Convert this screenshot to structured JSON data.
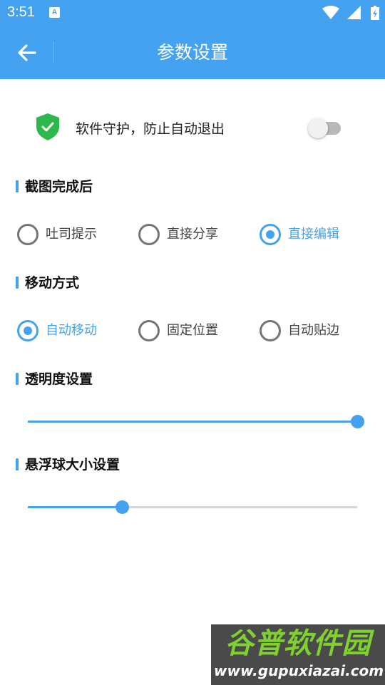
{
  "status_bar": {
    "time": "3:51",
    "app_icon_letter": "A"
  },
  "header": {
    "title": "参数设置"
  },
  "guard": {
    "label": "软件守护，防止自动退出",
    "enabled": false
  },
  "screenshot_section": {
    "title": "截图完成后",
    "options": [
      {
        "label": "吐司提示",
        "checked": false
      },
      {
        "label": "直接分享",
        "checked": false
      },
      {
        "label": "直接编辑",
        "checked": true
      }
    ]
  },
  "move_section": {
    "title": "移动方式",
    "options": [
      {
        "label": "自动移动",
        "checked": true
      },
      {
        "label": "固定位置",
        "checked": false
      },
      {
        "label": "自动贴边",
        "checked": false
      }
    ]
  },
  "opacity_section": {
    "title": "透明度设置",
    "value": 1.0
  },
  "ball_size_section": {
    "title": "悬浮球大小设置",
    "value": 0.285
  },
  "watermark": {
    "title": "谷普软件园",
    "url": "www.gupuxiazai.com"
  },
  "colors": {
    "accent": "#44a2f0",
    "header_bg": "#44a2f0",
    "shield_green": "#2db84d"
  }
}
